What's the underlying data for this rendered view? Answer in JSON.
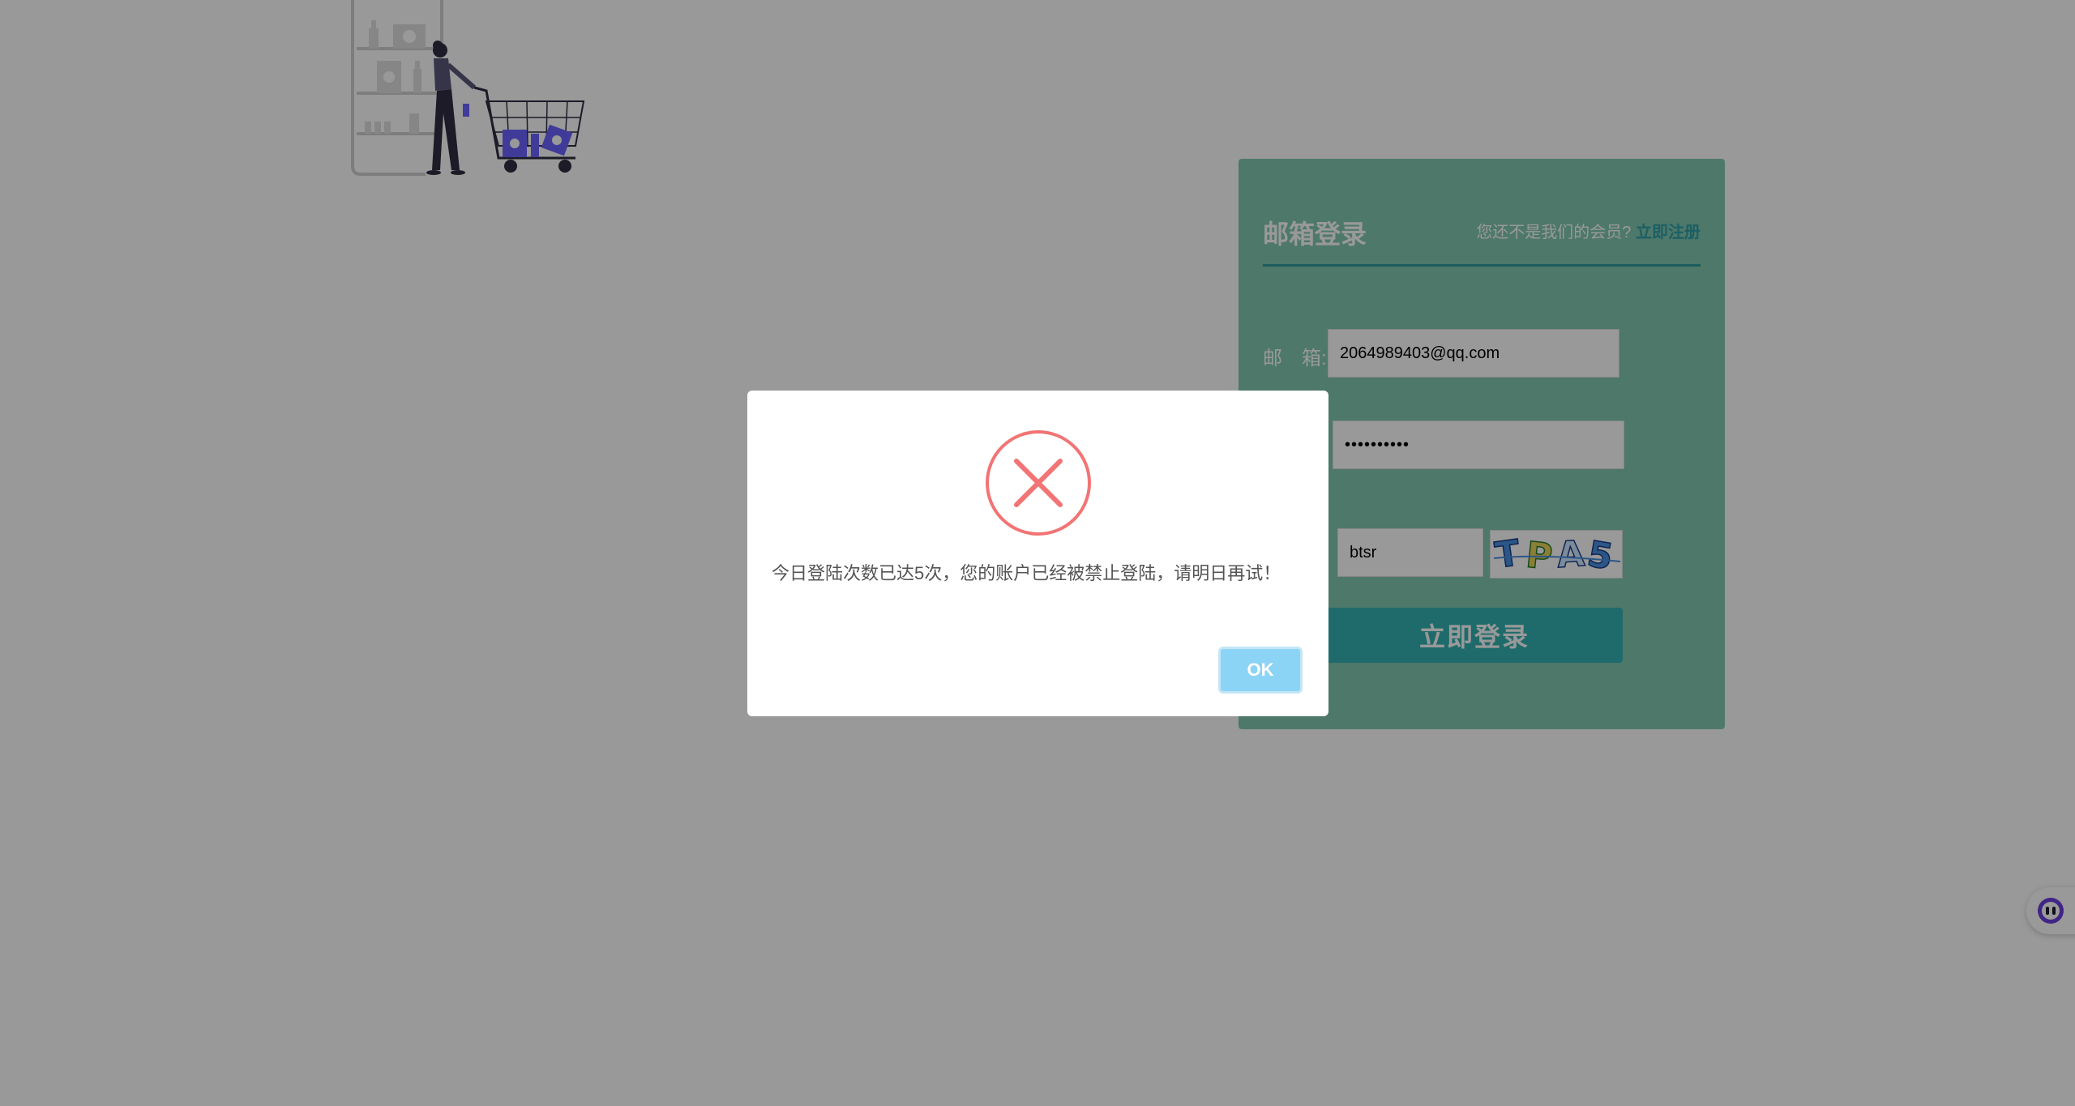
{
  "login": {
    "title": "邮箱登录",
    "register_prompt": "您还不是我们的会员?",
    "register_link": "立即注册",
    "email_label": "邮　箱:",
    "email_value": "2064989403@qq.com",
    "password_value": "••••••••••",
    "captcha_value": "btsr",
    "captcha_image_text": "TPA5",
    "submit_label": "立即登录"
  },
  "dialog": {
    "icon": "error-x-icon",
    "message": "今日登陆次数已达5次，您的账户已经被禁止登陆，请明日再试！",
    "ok_label": "OK"
  },
  "assistant": {
    "icon": "assistant-face-icon"
  },
  "colors": {
    "panel": "#80c9b1",
    "accent": "#2f9a9a",
    "button": "#35b3b3",
    "error": "#f27474",
    "ok_button": "#8cd4f5",
    "illustration_purple": "#6c63ff"
  }
}
